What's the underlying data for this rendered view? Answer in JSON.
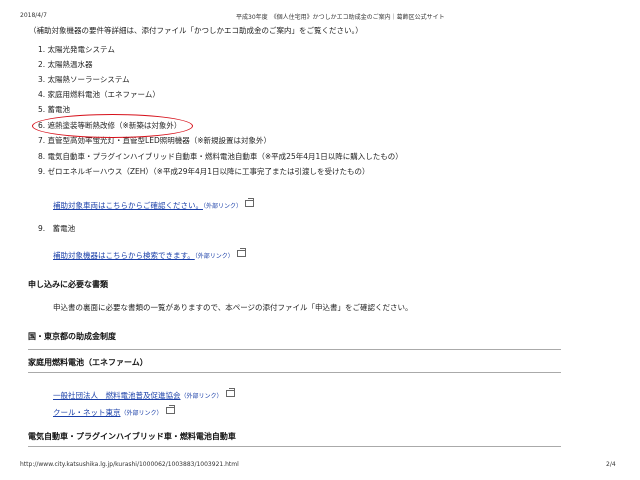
{
  "header": {
    "date": "2018/4/7",
    "title": "平成30年度　《個人住宅用》かつしかエコ助成金のご案内｜葛飾区公式サイト"
  },
  "intro": "（補助対象機器の要件等詳細は、添付ファイル「かつしかエコ助成金のご案内」をご覧ください。）",
  "items": [
    "1. 太陽光発電システム",
    "2. 太陽熱温水器",
    "3. 太陽熱ソーラーシステム",
    "4. 家庭用燃料電池（エネファーム）",
    "5. 蓄電池",
    "6. 遮熱塗装等断熱改修（※新築は対象外）",
    "7. 直管型高効率蛍光灯・直管型LED照明機器（※新規設置は対象外）",
    "8. 電気自動車・プラグインハイブリッド自動車・燃料電池自動車（※平成25年4月1日以降に購入したもの）",
    "9. ゼロエネルギーハウス（ZEH）（※平成29年4月1日以降に工事完了または引渡しを受けたもの）"
  ],
  "links": {
    "vehicles": "補助対象車両はこちらからご確認ください。",
    "devices": "補助対象機器はこちらから検索できます。",
    "ext_label": "（外部リンク）",
    "fuelcell_assoc": "一般社団法人　燃料電池普及促進協会",
    "cool_net": "クール・ネット東京"
  },
  "sub_item_9": "9.　蓄電池",
  "sections": {
    "documents_heading": "申し込みに必要な書類",
    "documents_text": "申込書の裏面に必要な書類の一覧がありますので、本ページの添付ファイル「申込書」をご確認ください。",
    "national_heading": "国・東京都の助成金制度",
    "fuelcell_heading": "家庭用燃料電池（エネファーム）",
    "ev_heading": "電気自動車・プラグインハイブリッド車・燃料電池自動車"
  },
  "footer": {
    "url": "http://www.city.katsushika.lg.jp/kurashi/1000062/1003883/1003921.html",
    "page": "2/4"
  },
  "colors": {
    "link": "#1a3fa8",
    "annotation_oval": "#d6101a"
  }
}
